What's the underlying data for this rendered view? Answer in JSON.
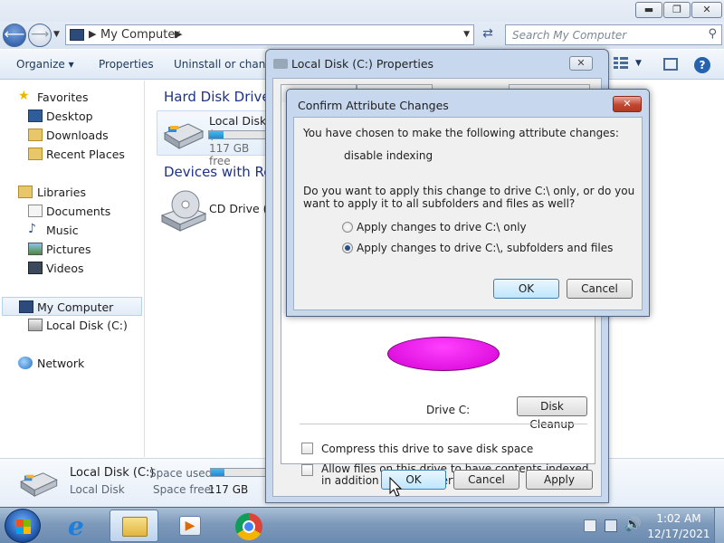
{
  "explorer": {
    "window_buttons": {
      "minimize": "▬",
      "maximize": "❐",
      "close": "✕"
    },
    "address": {
      "path": "My Computer",
      "separator": "▶"
    },
    "search": {
      "placeholder": "Search My Computer"
    },
    "toolbar": {
      "organize": "Organize ▾",
      "properties": "Properties",
      "uninstall": "Uninstall or change",
      "help": "?"
    },
    "sidebar": {
      "favorites": "Favorites",
      "desktop": "Desktop",
      "downloads": "Downloads",
      "recent": "Recent Places",
      "libraries": "Libraries",
      "documents": "Documents",
      "music": "Music",
      "pictures": "Pictures",
      "videos": "Videos",
      "computer": "My Computer",
      "local_disk": "Local Disk (C:)",
      "network": "Network"
    },
    "content": {
      "hard_disk_group": "Hard Disk Drives",
      "devices_group": "Devices with Rem",
      "local_disk_name": "Local Disk (",
      "local_disk_free": "117 GB free",
      "cd_drive_name": "CD Drive (D"
    },
    "details": {
      "name": "Local Disk (C:)",
      "type": "Local Disk",
      "space_used_label": "Space used:",
      "space_free_label": "Space free:",
      "space_free_value": "117 GB",
      "used_fraction": 0.25
    }
  },
  "properties_dialog": {
    "title": "Local Disk (C:) Properties",
    "close": "✕",
    "drive_label": "Drive C:",
    "disk_cleanup": "Disk Cleanup",
    "compress_label": "Compress this drive to save disk space",
    "index_label": "Allow files on this drive to have contents indexed in addition to file properties",
    "ok": "OK",
    "cancel": "Cancel",
    "apply": "Apply"
  },
  "confirm_dialog": {
    "title": "Confirm Attribute Changes",
    "close": "✕",
    "intro": "You have chosen to make the following attribute changes:",
    "change": "disable indexing",
    "question": "Do you want to apply this change to drive C:\\ only, or do you want to apply it to all subfolders and files as well?",
    "option1": "Apply changes to drive C:\\ only",
    "option2": "Apply changes to drive C:\\, subfolders and files",
    "selected_option": 2,
    "ok": "OK",
    "cancel": "Cancel"
  },
  "taskbar": {
    "time": "1:02 AM",
    "date": "12/17/2021"
  },
  "colors": {
    "accent": "#1e3287",
    "pie": "#ff00ff",
    "usage_bar": "#26a0da"
  }
}
